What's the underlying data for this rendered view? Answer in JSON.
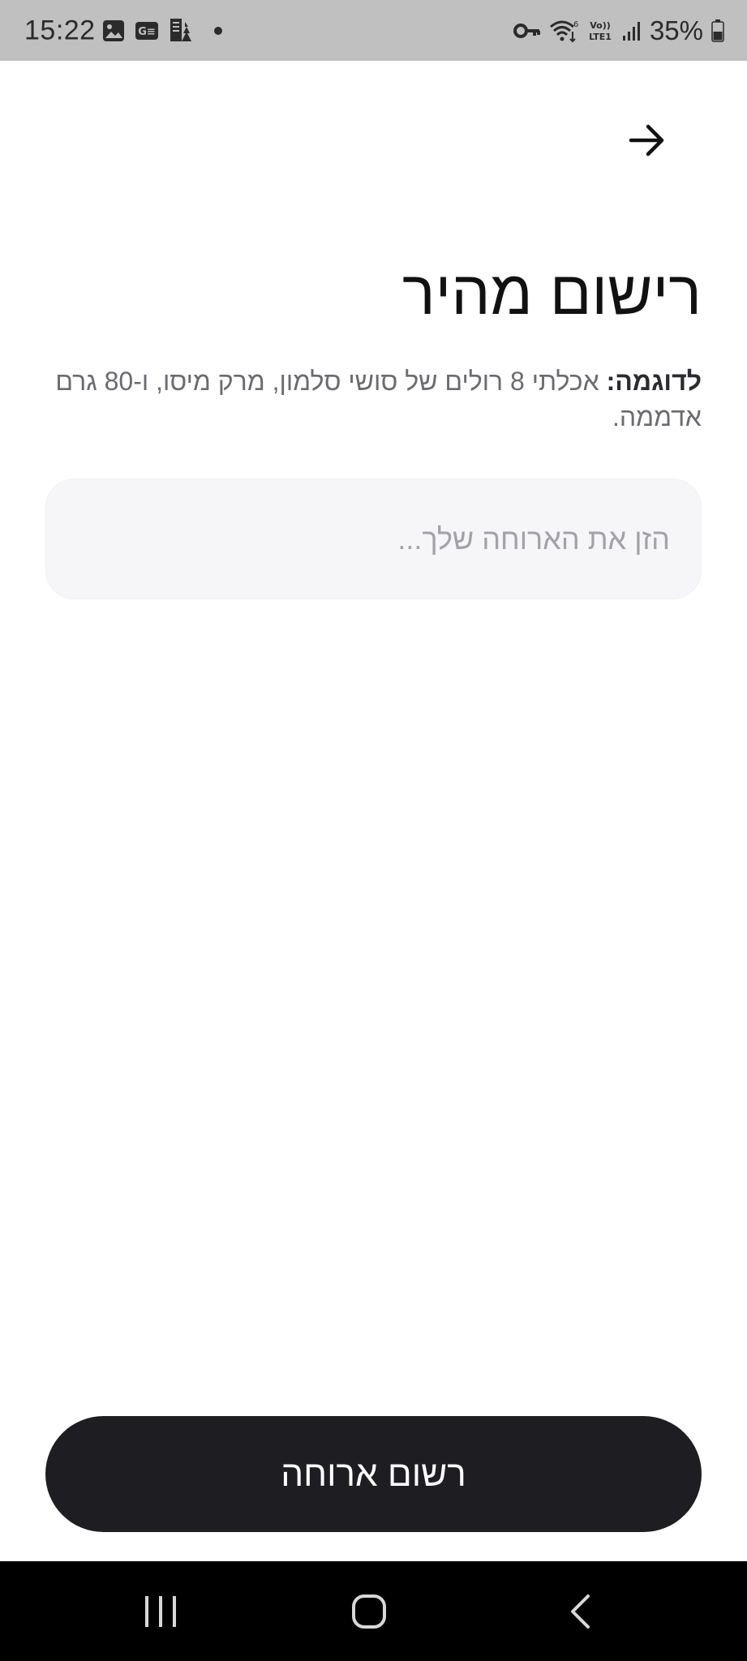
{
  "status_bar": {
    "time": "15:22",
    "battery": "35%",
    "left_icons": [
      "image-icon",
      "ge-icon",
      "news-icon",
      "dot-icon"
    ],
    "right_icons": [
      "key-icon",
      "wifi-icon",
      "volte-lte-icon",
      "signal-icon",
      "battery-icon"
    ],
    "volte_label": "Vo))",
    "lte_label": "LTE1"
  },
  "header": {
    "back_icon": "arrow-right-icon"
  },
  "main": {
    "title": "רישום מהיר",
    "example_label": "לדוגמה:",
    "example_text": " אכלתי 8 רולים של סושי סלמון, מרק מיסו, ו-80 גרם אדממה.",
    "input": {
      "value": "",
      "placeholder": "הזן את הארוחה שלך..."
    },
    "submit_label": "רשום ארוחה"
  },
  "nav_bar": {
    "icons": [
      "recents-icon",
      "home-icon",
      "back-icon"
    ]
  },
  "colors": {
    "status_bar_bg": "#c0c0c0",
    "button_bg": "#1e1d22",
    "input_bg": "#f6f6f8",
    "nav_bar_bg": "#000000"
  }
}
